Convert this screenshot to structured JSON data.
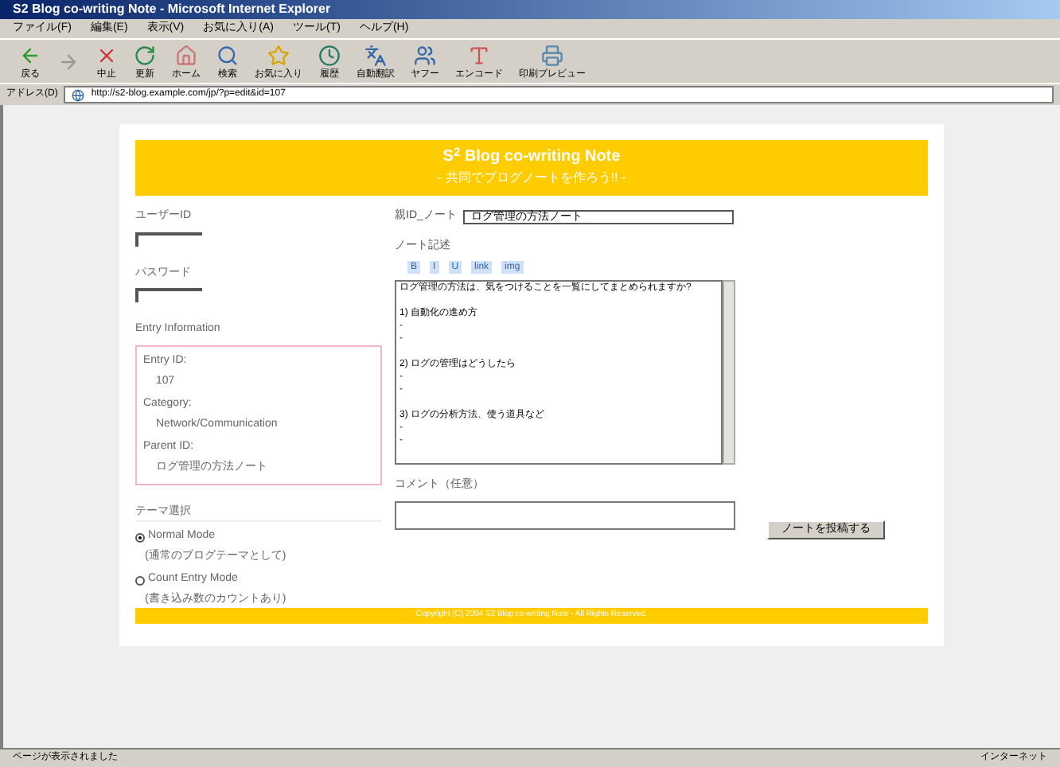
{
  "window": {
    "title": "S2 Blog co-writing Note - Microsoft Internet Explorer"
  },
  "menu": [
    "ファイル(F)",
    "編集(E)",
    "表示(V)",
    "お気に入り(A)",
    "ツール(T)",
    "ヘルプ(H)"
  ],
  "toolbar": [
    {
      "kind": "back",
      "label": "戻る"
    },
    {
      "kind": "forward"
    },
    {
      "kind": "stop",
      "label": "中止"
    },
    {
      "kind": "refresh",
      "label": "更新"
    },
    {
      "kind": "home",
      "label": "ホーム"
    },
    {
      "kind": "search",
      "label": "検索"
    },
    {
      "kind": "favorites",
      "label": "お気に入り"
    },
    {
      "kind": "history",
      "label": "履歴"
    },
    {
      "kind": "translate",
      "label": "自動翻訳"
    },
    {
      "kind": "people",
      "label": "ヤフー"
    },
    {
      "kind": "encode",
      "label": "エンコード"
    },
    {
      "kind": "print",
      "label": "印刷プレビュー"
    }
  ],
  "address": {
    "label": "アドレス(D)",
    "value": "http://s2-blog.example.com/jp/?p=edit&id=107"
  },
  "banner": {
    "title": "S$^{2}$ Blog co-writing Note",
    "subtitle": "- 共同でブログノートを作ろう!! -"
  },
  "login": {
    "user_label": "ユーザーID",
    "password_label": "パスワード"
  },
  "entry_info": {
    "title": "Entry Information",
    "fields": [
      {
        "label": "Entry ID:",
        "value": "107"
      },
      {
        "label": "Category:",
        "value": "Network/Communication"
      },
      {
        "label": "Parent ID:",
        "value": "ログ管理の方法ノート"
      }
    ]
  },
  "theme": {
    "title": "テーマ選択",
    "options": [
      {
        "label": "Normal Mode",
        "note": "(通常のブログテーマとして)",
        "selected": true
      },
      {
        "label": "Count Entry Mode",
        "note": "(書き込み数のカウントあり)",
        "selected": false
      }
    ]
  },
  "form": {
    "parent_label": "親ID_ノート",
    "parent_value": "ログ管理の方法ノート",
    "note_label": "ノート記述",
    "tags": [
      "B",
      "I",
      "U",
      "link",
      "img"
    ],
    "note_value": "ログ管理の方法は、気をつけることを一覧にしてまとめられますか?\n\n1) 自動化の進め方\n-\n-\n\n2) ログの管理はどうしたら\n-\n-\n\n3) ログの分析方法、使う道具など\n-\n-",
    "comment_label": "コメント（任意）",
    "submit": "ノートを投稿する"
  },
  "footer": "Copyright (C) 2004 S2 Blog co-writing Note - All Rights Reserved.",
  "status_bar": {
    "text": "ページが表示されました",
    "zone": "インターネット"
  }
}
